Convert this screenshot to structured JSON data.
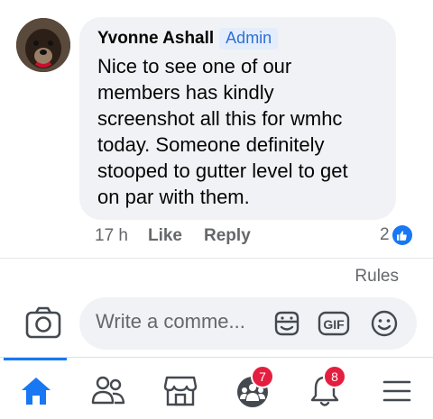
{
  "comment": {
    "author": "Yvonne Ashall",
    "badge": "Admin",
    "text": "Nice to see one of our\nmembers has kindly\nscreenshot all this for wmhc\ntoday.  Someone definitely\nstooped to gutter level to get\non par with them.",
    "time": "17 h",
    "like_label": "Like",
    "reply_label": "Reply",
    "reaction_count": "2"
  },
  "rules_label": "Rules",
  "composer": {
    "placeholder": "Write a comme..."
  },
  "tabbar": {
    "active": "home",
    "groups_badge": "7",
    "notifications_badge": "8"
  },
  "colors": {
    "accent": "#1877f2",
    "badge_red": "#e41e3f",
    "bubble": "#f0f2f5",
    "muted": "#65676b"
  },
  "icons": [
    "camera-icon",
    "sticker-icon",
    "gif-icon",
    "emoji-icon",
    "home-icon",
    "friends-icon",
    "marketplace-icon",
    "groups-icon",
    "notifications-icon",
    "menu-icon",
    "like-reaction-icon"
  ]
}
